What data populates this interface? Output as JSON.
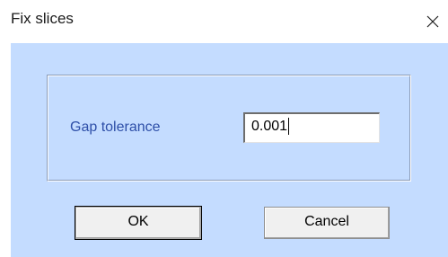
{
  "window": {
    "title": "Fix slices",
    "close_icon": "close-icon"
  },
  "form": {
    "gap_tolerance_label": "Gap tolerance",
    "gap_tolerance_value": "0.001"
  },
  "buttons": {
    "ok_label": "OK",
    "cancel_label": "Cancel"
  },
  "colors": {
    "client_background": "#c4dcff",
    "label_text": "#2e4fa8"
  }
}
